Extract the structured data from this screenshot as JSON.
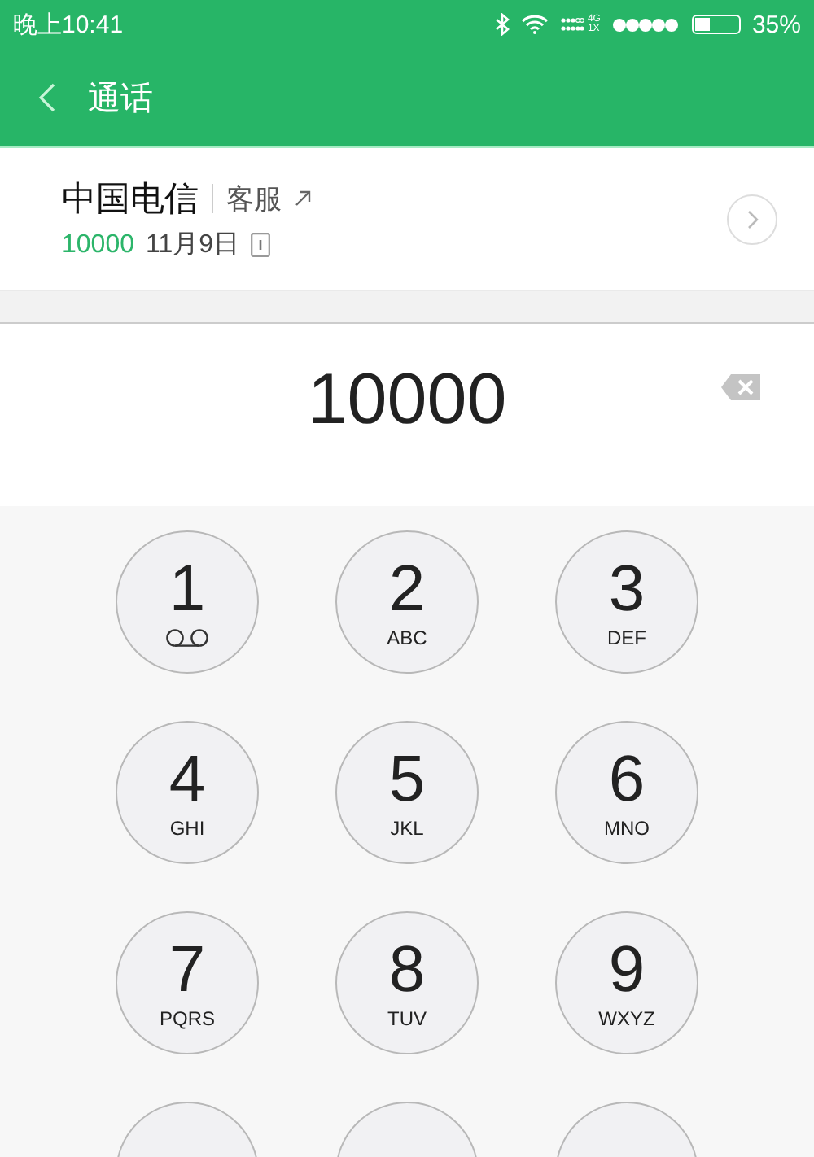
{
  "status_bar": {
    "time": "晚上10:41",
    "network": "4G",
    "network_alt": "1X",
    "battery": "35%"
  },
  "header": {
    "title": "通话"
  },
  "contact": {
    "name": "中国电信",
    "tag": "客服",
    "number": "10000",
    "date": "11月9日"
  },
  "dialed": "10000",
  "keypad": [
    {
      "digit": "1",
      "kind": "voicemail"
    },
    {
      "digit": "2",
      "letters": "ABC",
      "kind": "key"
    },
    {
      "digit": "3",
      "letters": "DEF",
      "kind": "key"
    },
    {
      "digit": "4",
      "letters": "GHI",
      "kind": "key"
    },
    {
      "digit": "5",
      "letters": "JKL",
      "kind": "key"
    },
    {
      "digit": "6",
      "letters": "MNO",
      "kind": "key"
    },
    {
      "digit": "7",
      "letters": "PQRS",
      "kind": "key"
    },
    {
      "digit": "8",
      "letters": "TUV",
      "kind": "key"
    },
    {
      "digit": "9",
      "letters": "WXYZ",
      "kind": "key"
    },
    {
      "kind": "cut"
    },
    {
      "kind": "cut"
    },
    {
      "kind": "cut"
    }
  ]
}
